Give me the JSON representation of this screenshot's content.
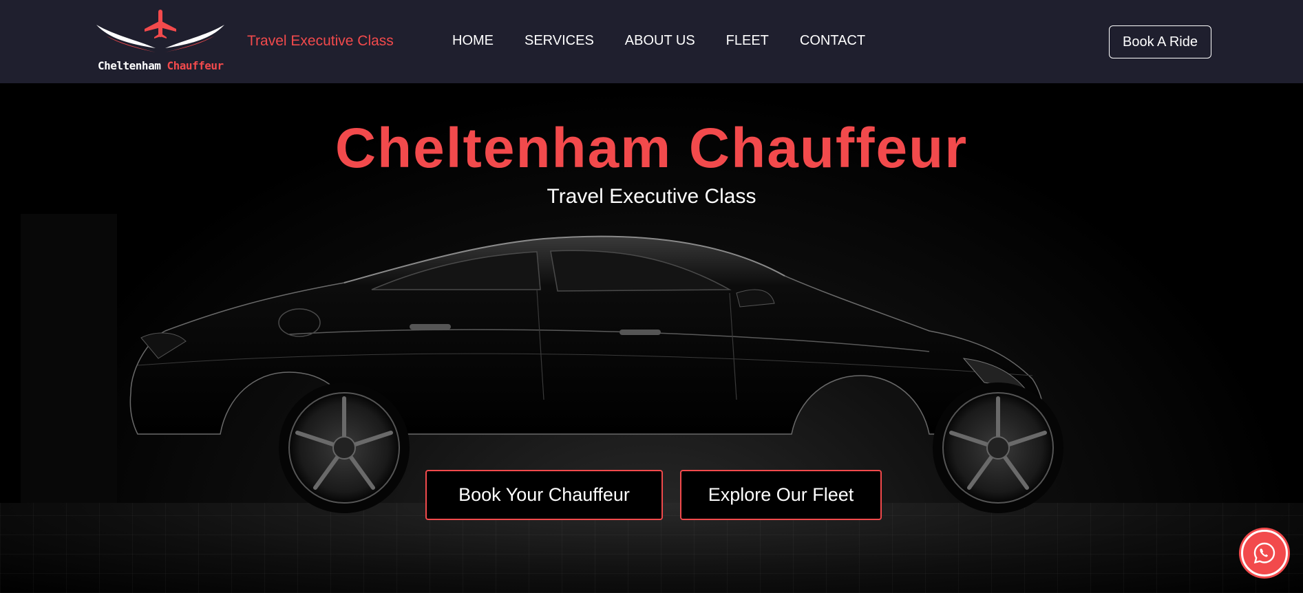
{
  "header": {
    "logo": {
      "brand_part1": "Cheltenham",
      "brand_part2": "Chauffeur",
      "icon": "plane-wings-logo"
    },
    "tagline": "Travel Executive Class",
    "nav": [
      {
        "label": "HOME"
      },
      {
        "label": "SERVICES"
      },
      {
        "label": "ABOUT US"
      },
      {
        "label": "FLEET"
      },
      {
        "label": "CONTACT"
      }
    ],
    "book_ride_label": "Book A Ride"
  },
  "hero": {
    "title": "Cheltenham Chauffeur",
    "subtitle": "Travel Executive Class",
    "buttons": {
      "book": "Book Your Chauffeur",
      "fleet": "Explore Our Fleet"
    },
    "image": "black-sedan-silhouette"
  },
  "floating": {
    "whatsapp_icon": "whatsapp-icon"
  },
  "colors": {
    "header_bg": "#1f1f2e",
    "accent": "#f24a4c",
    "text": "#ffffff",
    "hero_bg": "#000000"
  }
}
